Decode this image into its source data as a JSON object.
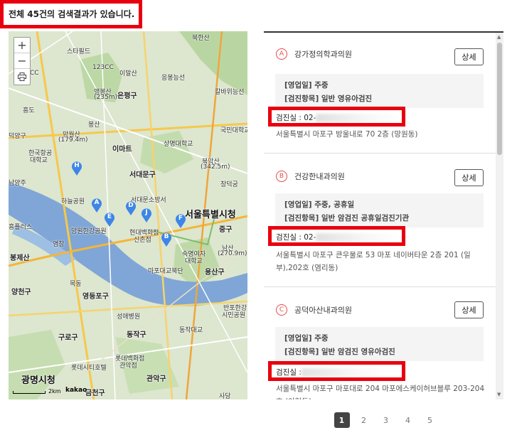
{
  "result_count": "전체 45건의 검색결과가 있습니다.",
  "map": {
    "zoom_in": "+",
    "zoom_out": "−",
    "print_icon": "print-icon",
    "scale_label": "2km",
    "provider": "kakao",
    "labels": [
      "북한산",
      "스타필드",
      "123CC",
      "이말산",
      "응봉능선",
      "칼바위능선",
      "앵봉산",
      "(235m)",
      "은평구",
      "봉산",
      "흥도",
      "국민대학교",
      "덕양구",
      "망월산",
      "(179.4m)",
      "이마트",
      "상명대학교",
      "한국항공",
      "대학교",
      "북악산",
      "(342.5m)",
      "창덕궁",
      "서대문구",
      "서대문소방서",
      "서울특별시청",
      "하늘공원",
      "망원한강공원",
      "현대백화점",
      "신촌점",
      "중구",
      "흥플러스",
      "남산",
      "(270.9m)",
      "숙명여자",
      "대학교",
      "마포대교북단",
      "봉제산",
      "용산구",
      "양천구",
      "영등포구",
      "목동",
      "성애병원",
      "동작구",
      "동작대교",
      "반포한강",
      "시민공원",
      "구로구",
      "롯데백화점",
      "관악점",
      "롯데시티호텔",
      "광명시청",
      "관악구",
      "금천구",
      "사당",
      "염창",
      "남양주",
      "CC"
    ],
    "markers": [
      "A",
      "B",
      "D",
      "E",
      "F",
      "H",
      "J"
    ]
  },
  "clinics": [
    {
      "letter": "A",
      "name": "강가정의학과의원",
      "detail_label": "상세",
      "business_days": "[영업일] 주중",
      "checkup_items": "[검진항목] 일반 영유아검진",
      "phone": "검진실 : 02-",
      "address": "서울특별시 마포구 방울내로 70 2층 (망원동)"
    },
    {
      "letter": "B",
      "name": "건강한내과의원",
      "detail_label": "상세",
      "business_days": "[영업일] 주중, 공휴일",
      "checkup_items": "[검진항목] 일반 암검진 공휴일검진기관",
      "phone": "검진실 : 02-",
      "address": "서울특별시 마포구 큰우물로 53 마포 네이버타운 2층 201 (일부),202호 (염리동)"
    },
    {
      "letter": "C",
      "name": "공덕아산내과의원",
      "detail_label": "상세",
      "business_days": "[영업일] 주중",
      "checkup_items": "[검진항목] 일반 암검진 영유아검진",
      "phone": "검진실 :",
      "address": "서울특별시 마포구 마포대로 204 마포에스케이허브블루 203-204호 (아현동)"
    }
  ],
  "pagination": [
    "1",
    "2",
    "3",
    "4",
    "5"
  ],
  "colors": {
    "accent": "#e8000f",
    "letter": "#e34c4c",
    "marker": "#3d86e8"
  }
}
